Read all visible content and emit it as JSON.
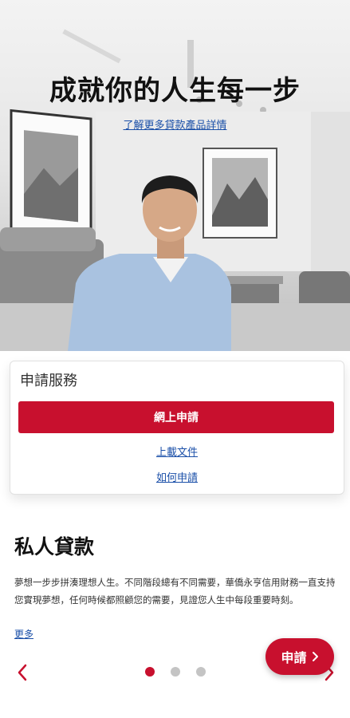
{
  "hero": {
    "title": "成就你的人生每一步",
    "link": "了解更多貸款產品詳情"
  },
  "apply_card": {
    "title": "申請服務",
    "primary_button": "網上申請",
    "upload_link": "上載文件",
    "how_to_link": "如何申請"
  },
  "product": {
    "title": "私人貸款",
    "description": "夢想一步步拼湊理想人生。不同階段總有不同需要，華僑永亨信用財務一直支持您實現夢想，任何時候都照顧您的需要，見證您人生中每段重要時刻。",
    "more_link": "更多"
  },
  "carousel": {
    "active_index": 0,
    "count": 3
  },
  "fab": {
    "label": "申請"
  },
  "icons": {
    "prev": "chevron-left-icon",
    "next": "chevron-right-icon",
    "fab_chevron": "chevron-right-icon"
  },
  "colors": {
    "accent": "#c8102e",
    "link": "#1a4fa8",
    "dot_inactive": "#c4c4c4"
  }
}
